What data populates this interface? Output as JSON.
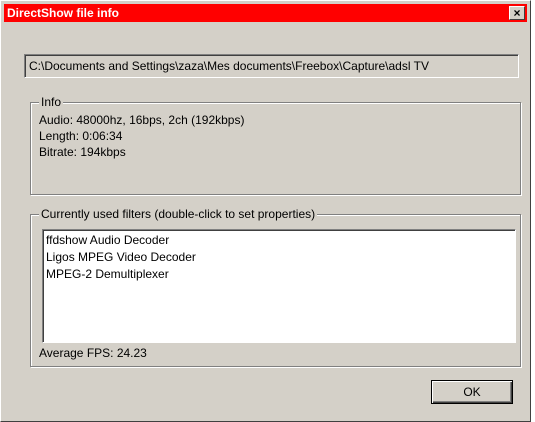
{
  "window": {
    "title": "DirectShow file info",
    "close_glyph": "✕"
  },
  "file_path": "C:\\Documents and Settings\\zaza\\Mes documents\\Freebox\\Capture\\adsl TV",
  "info": {
    "label": "Info",
    "audio": "Audio: 48000hz, 16bps, 2ch (192kbps)",
    "length": "Length: 0:06:34",
    "bitrate": "Bitrate: 194kbps"
  },
  "filters": {
    "label": "Currently used filters (double-click to set properties)",
    "items": [
      "ffdshow Audio Decoder",
      "Ligos MPEG Video Decoder",
      "MPEG-2 Demultiplexer"
    ],
    "average_fps": "Average FPS: 24.23"
  },
  "buttons": {
    "ok": "OK"
  },
  "colors": {
    "titlebar": "#ff0000",
    "face": "#d4d0c8"
  }
}
